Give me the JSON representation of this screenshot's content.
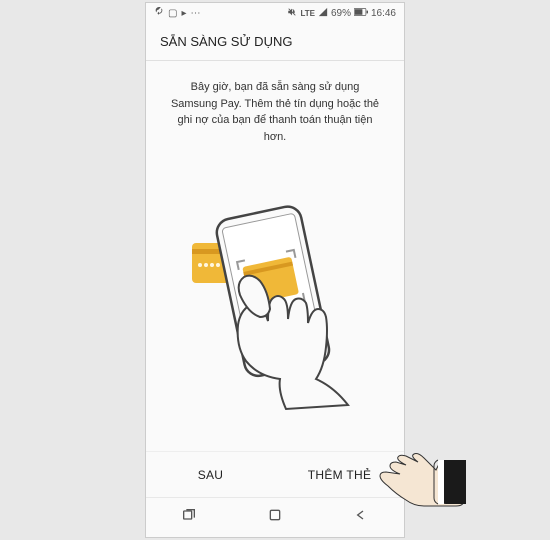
{
  "status": {
    "battery_text": "69%",
    "time": "16:46"
  },
  "header": {
    "title": "SẴN SÀNG SỬ DỤNG"
  },
  "content": {
    "body": "Bây giờ, bạn đã sẵn sàng sử dụng Samsung Pay. Thêm thẻ tín dụng hoặc thẻ ghi nợ của bạn để thanh toán thuận tiện hơn."
  },
  "buttons": {
    "later": "SAU",
    "add_card": "THÊM THẺ"
  },
  "colors": {
    "card_yellow": "#f0b838",
    "hand_cuff": "#1a1a1a"
  }
}
